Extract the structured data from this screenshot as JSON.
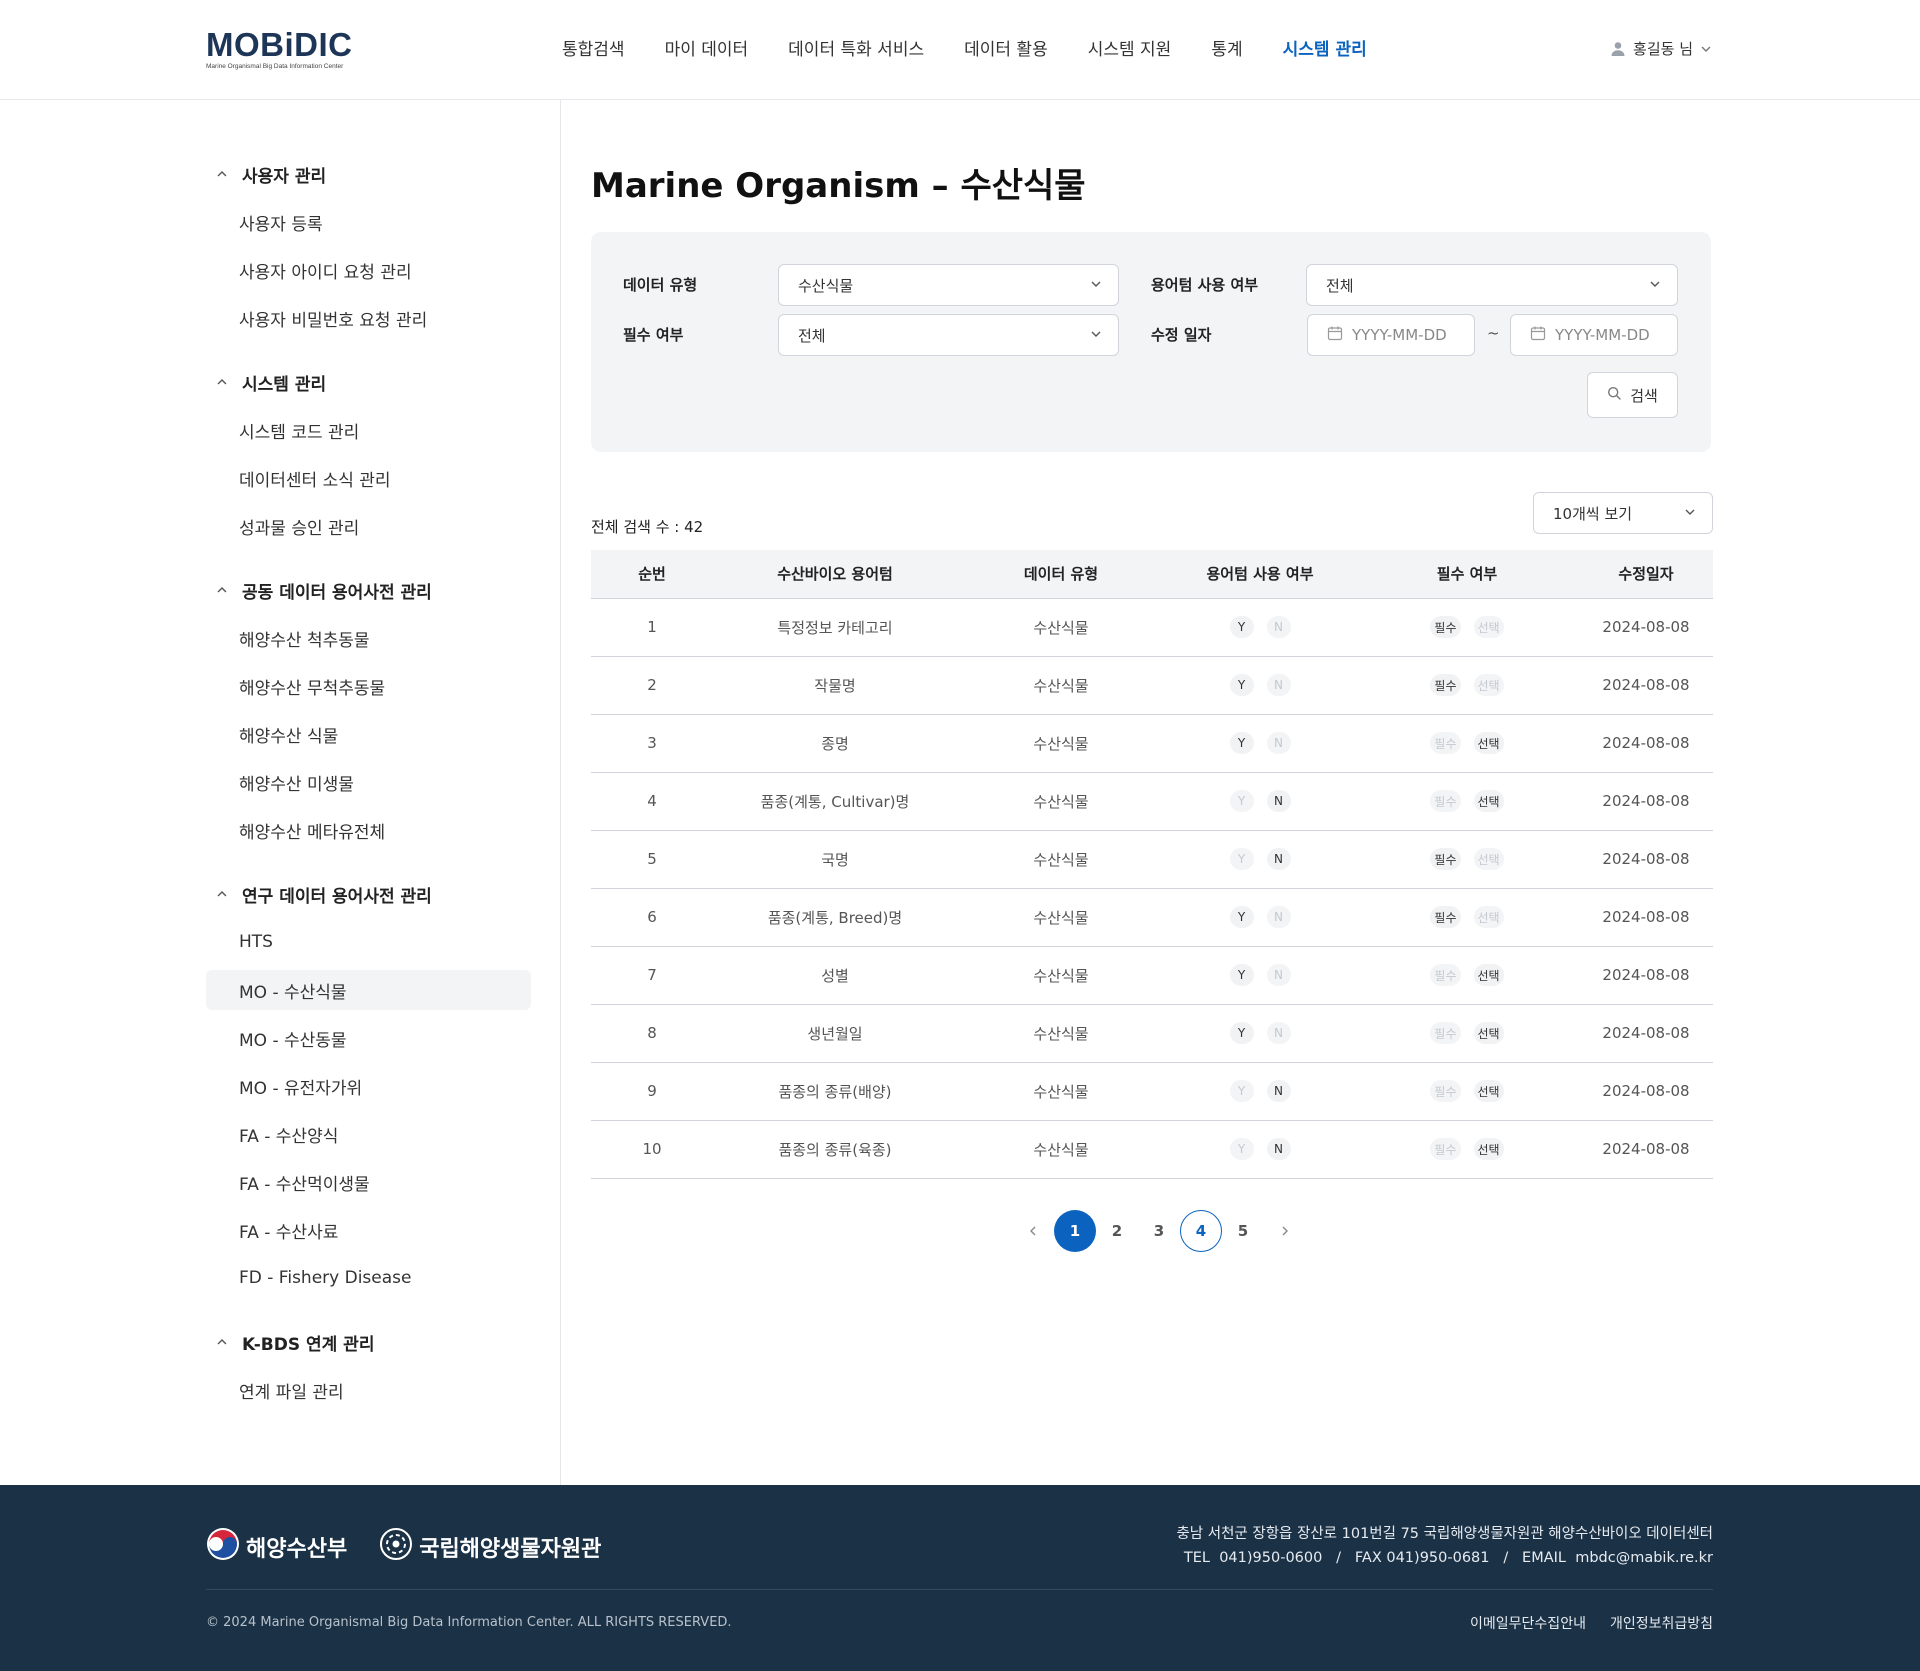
{
  "header": {
    "logo_main": "MOBiDIC",
    "logo_sub": "Marine Organismal Big Data Information Center",
    "nav": [
      "통합검색",
      "마이 데이터",
      "데이터 특화 서비스",
      "데이터 활용",
      "시스템 지원",
      "통계",
      "시스템 관리"
    ],
    "nav_active": "시스템 관리",
    "user_name": "홍길동 님"
  },
  "sidebar": {
    "groups": [
      {
        "title": "사용자 관리",
        "items": [
          "사용자 등록",
          "사용자 아이디 요청 관리",
          "사용자 비밀번호 요청 관리"
        ]
      },
      {
        "title": "시스템 관리",
        "items": [
          "시스템 코드 관리",
          "데이터센터 소식 관리",
          "성과물 승인 관리"
        ]
      },
      {
        "title": "공동 데이터 용어사전 관리",
        "items": [
          "해양수산 척추동물",
          "해양수산 무척추동물",
          "해양수산 식물",
          "해양수산 미생물",
          "해양수산 메타유전체"
        ]
      },
      {
        "title": "연구 데이터 용어사전 관리",
        "items": [
          "HTS",
          "MO - 수산식물",
          "MO - 수산동물",
          "MO - 유전자가위",
          "FA - 수산양식",
          "FA - 수산먹이생물",
          "FA - 수산사료",
          "FD - Fishery Disease"
        ]
      },
      {
        "title": "K-BDS 연계 관리",
        "items": [
          "연계 파일 관리"
        ]
      }
    ],
    "active_item": "MO - 수산식물"
  },
  "main": {
    "title": "Marine Organism – 수산식물",
    "filter": {
      "data_type_label": "데이터 유형",
      "data_type_value": "수산식물",
      "term_use_label": "용어텀 사용 여부",
      "term_use_value": "전체",
      "required_label": "필수 여부",
      "required_value": "전체",
      "modified_label": "수정 일자",
      "date_from_placeholder": "YYYY-MM-DD",
      "date_to_placeholder": "YYYY-MM-DD",
      "tilde": "~",
      "search_label": "검색"
    },
    "total_label": "전체 검색 수 : 42",
    "per_page": "10개씩 보기",
    "table": {
      "headers": [
        "순번",
        "수산바이오 용어텀",
        "데이터 유형",
        "용어텀 사용 여부",
        "필수 여부",
        "수정일자"
      ],
      "rows": [
        {
          "no": "1",
          "term": "특정정보 카테고리",
          "type": "수산식물",
          "use": "Y",
          "req": "필수",
          "date": "2024-08-08"
        },
        {
          "no": "2",
          "term": "작물명",
          "type": "수산식물",
          "use": "Y",
          "req": "필수",
          "date": "2024-08-08"
        },
        {
          "no": "3",
          "term": "종명",
          "type": "수산식물",
          "use": "Y",
          "req": "선택",
          "date": "2024-08-08"
        },
        {
          "no": "4",
          "term": "품종(계통, Cultivar)명",
          "type": "수산식물",
          "use": "N",
          "req": "선택",
          "date": "2024-08-08"
        },
        {
          "no": "5",
          "term": "국명",
          "type": "수산식물",
          "use": "N",
          "req": "필수",
          "date": "2024-08-08"
        },
        {
          "no": "6",
          "term": "품종(계통, Breed)명",
          "type": "수산식물",
          "use": "Y",
          "req": "필수",
          "date": "2024-08-08"
        },
        {
          "no": "7",
          "term": "성별",
          "type": "수산식물",
          "use": "Y",
          "req": "선택",
          "date": "2024-08-08"
        },
        {
          "no": "8",
          "term": "생년월일",
          "type": "수산식물",
          "use": "Y",
          "req": "선택",
          "date": "2024-08-08"
        },
        {
          "no": "9",
          "term": "품종의 종류(배양)",
          "type": "수산식물",
          "use": "N",
          "req": "선택",
          "date": "2024-08-08"
        },
        {
          "no": "10",
          "term": "품종의 종류(육종)",
          "type": "수산식물",
          "use": "N",
          "req": "선택",
          "date": "2024-08-08"
        }
      ]
    },
    "yn": {
      "y": "Y",
      "n": "N"
    },
    "req_opts": {
      "required": "필수",
      "optional": "선택"
    },
    "pagination": {
      "pages": [
        "1",
        "2",
        "3",
        "4",
        "5"
      ],
      "current": "1",
      "outlined": "4"
    }
  },
  "footer": {
    "logo1": "해양수산부",
    "logo2": "국립해양생물자원관",
    "address": "충남 서천군 장항읍 장산로 101번길 75 국립해양생물자원관 해양수산바이오 데이터센터",
    "contact": "TEL  041)950-0600   /   FAX 041)950-0681   /   EMAIL  mbdc@mabik.re.kr",
    "copyright": "© 2024 Marine Organismal Big Data Information Center. ALL RIGHTS RESERVED.",
    "links": [
      "이메일무단수집안내",
      "개인정보취급방침"
    ]
  },
  "colors": {
    "accent": "#0b63bf",
    "footer_bg": "#1b3145",
    "panel_bg": "#f3f4f6"
  }
}
